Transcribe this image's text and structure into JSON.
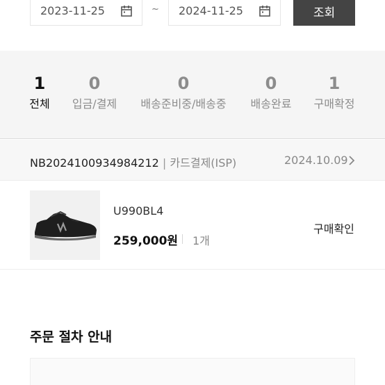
{
  "filter": {
    "start_date": "2023-11-25",
    "separator": "~",
    "end_date": "2024-11-25",
    "search_label": "조회"
  },
  "status_tabs": [
    {
      "count": "1",
      "label": "전체",
      "active": true
    },
    {
      "count": "0",
      "label": "입금/결제",
      "active": false
    },
    {
      "count": "0",
      "label": "배송준비중/배송중",
      "active": false
    },
    {
      "count": "0",
      "label": "배송완료",
      "active": false
    },
    {
      "count": "1",
      "label": "구매확정",
      "active": false
    }
  ],
  "order": {
    "number": "NB2024100934984212",
    "separator": "|",
    "payment": "카드결제(ISP)",
    "date": "2024.10.09",
    "item": {
      "name": "U990BL4",
      "price": "259,000원",
      "quantity": "1개",
      "status": "구매확인"
    }
  },
  "guide": {
    "title": "주문 절차 안내"
  },
  "colors": {
    "button_bg": "#444444",
    "status_bar_bg": "#f5f5f5",
    "active_tab": "#111111",
    "inactive_tab": "#8c8c8c"
  }
}
